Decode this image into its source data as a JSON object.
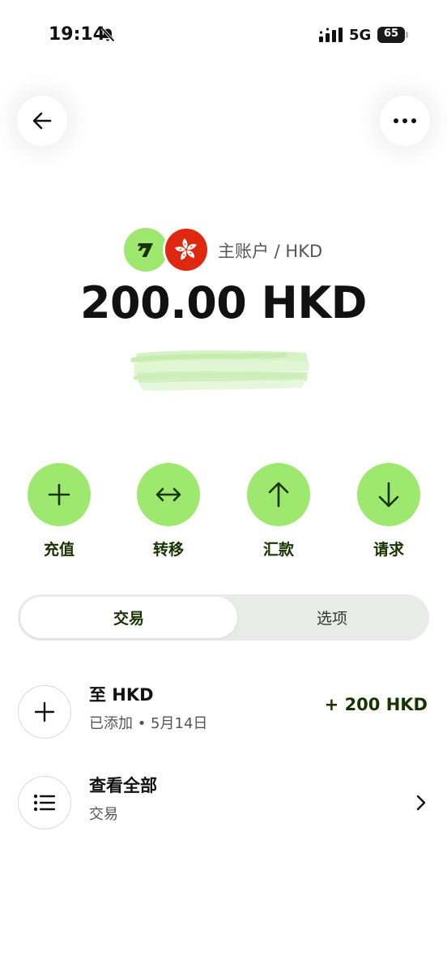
{
  "status_bar": {
    "time": "19:14",
    "network": "5G",
    "battery": "65"
  },
  "icons": {
    "back": "arrow-left-icon",
    "more": "more-horizontal-icon",
    "silent": "bell-slash-icon",
    "topup": "plus-icon",
    "transfer": "arrows-horizontal-icon",
    "send": "arrow-up-icon",
    "request": "arrow-down-icon",
    "list": "list-icon",
    "chevron": "chevron-right-icon",
    "brand": "wise-logo-icon",
    "flag": "hong-kong-flag-icon"
  },
  "account": {
    "label": "主账户 / HKD",
    "balance": "200.00 HKD"
  },
  "actions": {
    "topup": "充值",
    "transfer": "转移",
    "send": "汇款",
    "request": "请求"
  },
  "tabs": {
    "active": "交易",
    "inactive": "选项"
  },
  "transaction": {
    "title": "至 HKD",
    "subtitle": "已添加 • 5月14日",
    "amount": "+ 200 HKD"
  },
  "view_all": {
    "title": "查看全部",
    "subtitle": "交易"
  },
  "colors": {
    "accent": "#9fe870",
    "accent_text": "#163300",
    "flag_red": "#de2910",
    "segment_bg": "#e9ebe9"
  }
}
